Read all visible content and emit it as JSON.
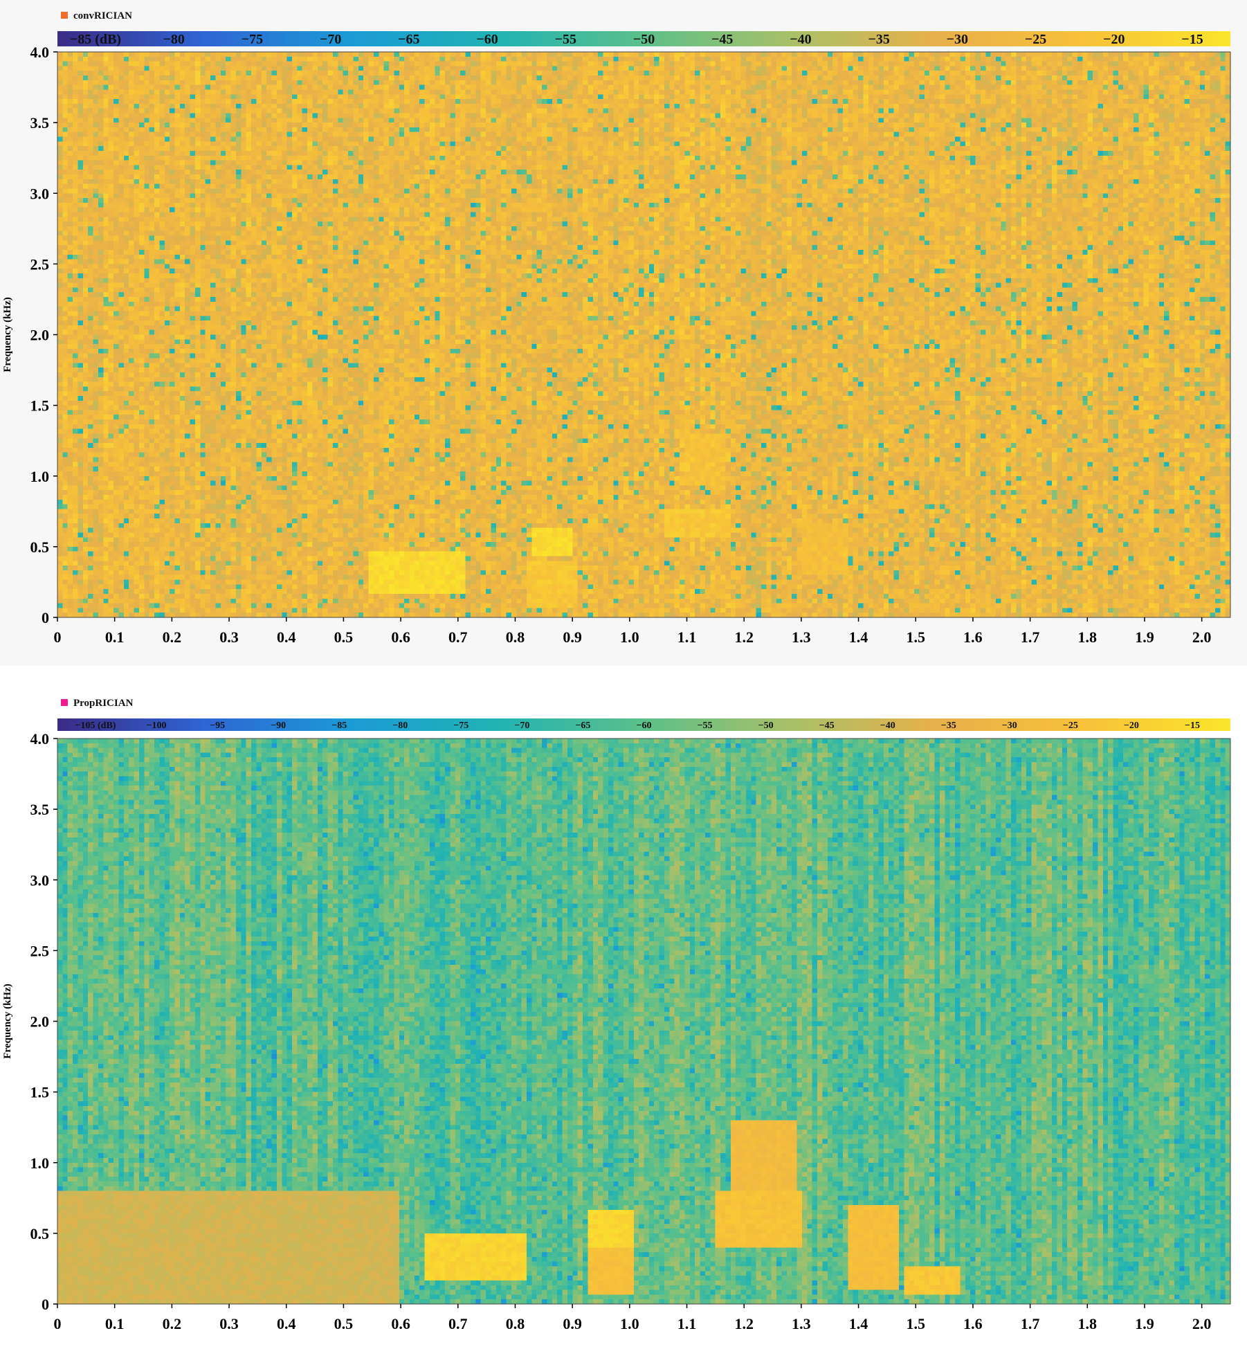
{
  "chart_data": [
    {
      "type": "heatmap",
      "title": "",
      "legend": {
        "label": "convRICIAN",
        "color": "#f26d2b",
        "placement": "top-left"
      },
      "xlabel": "",
      "ylabel": "Frequency (kHz)",
      "xlim": [
        0,
        2.05
      ],
      "ylim": [
        0,
        4.0
      ],
      "x_ticks": [
        "0",
        "0.1",
        "0.2",
        "0.3",
        "0.4",
        "0.5",
        "0.6",
        "0.7",
        "0.8",
        "0.9",
        "1.0",
        "1.1",
        "1.2",
        "1.3",
        "1.4",
        "1.5",
        "1.6",
        "1.7",
        "1.8",
        "1.9",
        "2.0"
      ],
      "y_ticks": [
        "0",
        "0.5",
        "1.0",
        "1.5",
        "2.0",
        "2.5",
        "3.0",
        "3.5",
        "4.0"
      ],
      "colorbar": {
        "labels": [
          "−85 (dB)",
          "−80",
          "−75",
          "−70",
          "−65",
          "−60",
          "−55",
          "−50",
          "−45",
          "−40",
          "−35",
          "−30",
          "−25",
          "−20",
          "−15"
        ],
        "range": [
          -88,
          -13
        ],
        "colors": [
          "#3b2a86",
          "#2f65d4",
          "#1b9bd6",
          "#21b3b3",
          "#5cc08a",
          "#a8c068",
          "#e8b04a",
          "#f7c13a",
          "#fbe62b"
        ]
      },
      "background_level_db": -28,
      "grid": false,
      "blobs": [
        {
          "t": [
            0.54,
            0.71
          ],
          "f": [
            0.18,
            0.48
          ],
          "level_db": -16
        },
        {
          "t": [
            0.83,
            0.9
          ],
          "f": [
            0.42,
            0.62
          ],
          "level_db": -16
        },
        {
          "t": [
            0.82,
            0.91
          ],
          "f": [
            0.05,
            0.4
          ],
          "level_db": -21
        },
        {
          "t": [
            1.06,
            1.18
          ],
          "f": [
            0.55,
            0.75
          ],
          "level_db": -21
        },
        {
          "t": [
            1.1,
            1.17
          ],
          "f": [
            0.95,
            1.3
          ],
          "level_db": -23
        },
        {
          "t": [
            1.3,
            1.38
          ],
          "f": [
            0.3,
            0.65
          ],
          "level_db": -24
        }
      ]
    },
    {
      "type": "heatmap",
      "title": "",
      "legend": {
        "label": "PropRICIAN",
        "color": "#ee1c8e",
        "placement": "top-left"
      },
      "xlabel": "",
      "ylabel": "Frequency (kHz)",
      "xlim": [
        0,
        2.05
      ],
      "ylim": [
        0,
        4.0
      ],
      "x_ticks": [
        "0",
        "0.1",
        "0.2",
        "0.3",
        "0.4",
        "0.5",
        "0.6",
        "0.7",
        "0.8",
        "0.9",
        "1.0",
        "1.1",
        "1.2",
        "1.3",
        "1.4",
        "1.5",
        "1.6",
        "1.7",
        "1.8",
        "1.9",
        "2.0"
      ],
      "y_ticks": [
        "0",
        "0.5",
        "1.0",
        "1.5",
        "2.0",
        "2.5",
        "3.0",
        "3.5",
        "4.0"
      ],
      "colorbar": {
        "labels": [
          "−105 (dB)",
          "−100",
          "−95",
          "−90",
          "−85",
          "−80",
          "−75",
          "−70",
          "−65",
          "−60",
          "−55",
          "−50",
          "−45",
          "−40",
          "−35",
          "−30",
          "−25",
          "−20",
          "−15"
        ],
        "range": [
          -108,
          -12
        ],
        "colors": [
          "#3b2a86",
          "#2f65d4",
          "#1b9bd6",
          "#21b3b3",
          "#5cc08a",
          "#a8c068",
          "#e8b04a",
          "#f7c13a",
          "#fbe62b"
        ]
      },
      "background_level_db": -60,
      "grid": false,
      "blobs": [
        {
          "t": [
            0.64,
            0.82
          ],
          "f": [
            0.15,
            0.5
          ],
          "level_db": -18
        },
        {
          "t": [
            0.93,
            1.01
          ],
          "f": [
            0.4,
            0.65
          ],
          "level_db": -17
        },
        {
          "t": [
            0.93,
            1.01
          ],
          "f": [
            0.05,
            0.4
          ],
          "level_db": -25
        },
        {
          "t": [
            0.0,
            0.6
          ],
          "f": [
            0.0,
            0.8
          ],
          "level_db": -40
        },
        {
          "t": [
            1.15,
            1.3
          ],
          "f": [
            0.4,
            0.8
          ],
          "level_db": -24
        },
        {
          "t": [
            1.18,
            1.29
          ],
          "f": [
            0.8,
            1.3
          ],
          "level_db": -28
        },
        {
          "t": [
            1.38,
            1.47
          ],
          "f": [
            0.1,
            0.7
          ],
          "level_db": -26
        },
        {
          "t": [
            1.48,
            1.58
          ],
          "f": [
            0.05,
            0.25
          ],
          "level_db": -22
        }
      ]
    }
  ]
}
